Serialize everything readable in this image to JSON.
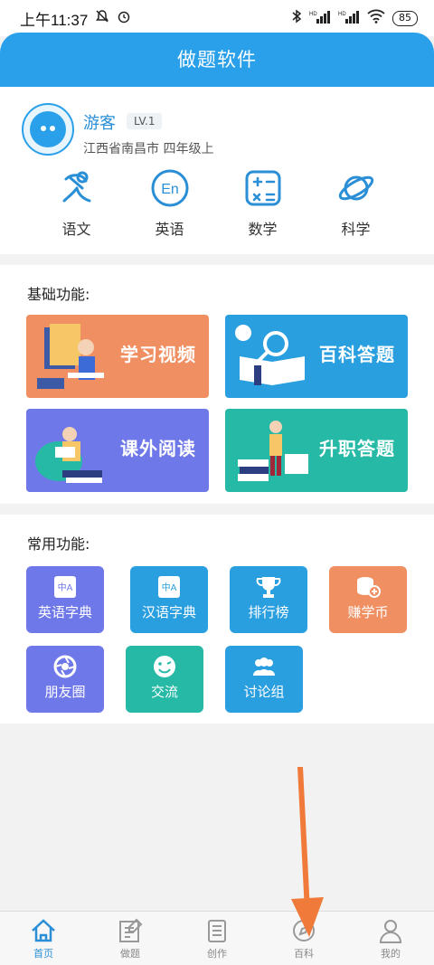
{
  "status": {
    "time": "上午11:37",
    "signal1": "HD",
    "signal2": "HD",
    "battery": "85"
  },
  "app": {
    "title": "做题软件"
  },
  "profile": {
    "name": "游客",
    "level": "LV.1",
    "location": "江西省南昌市  四年级上"
  },
  "subjects": [
    {
      "label": "语文",
      "icon": "chinese-icon"
    },
    {
      "label": "英语",
      "icon": "english-icon",
      "glyph": "En"
    },
    {
      "label": "数学",
      "icon": "math-icon"
    },
    {
      "label": "科学",
      "icon": "science-icon"
    }
  ],
  "basic": {
    "title": "基础功能:",
    "cards": [
      {
        "label": "学习视频",
        "color": "#ef8f62"
      },
      {
        "label": "百科答题",
        "color": "#2a9fe0"
      },
      {
        "label": "课外阅读",
        "color": "#6f78e8"
      },
      {
        "label": "升职答题",
        "color": "#25b9a6"
      }
    ]
  },
  "common": {
    "title": "常用功能:",
    "tiles": [
      {
        "label": "英语字典",
        "color": "#6f78e8",
        "glyph": "中A"
      },
      {
        "label": "汉语字典",
        "color": "#2a9fe0",
        "glyph": "中A"
      },
      {
        "label": "排行榜",
        "color": "#2a9fe0"
      },
      {
        "label": "赚学币",
        "color": "#ef8f62"
      },
      {
        "label": "朋友圈",
        "color": "#6f78e8"
      },
      {
        "label": "交流",
        "color": "#25b9a6"
      },
      {
        "label": "讨论组",
        "color": "#2a9fe0"
      }
    ]
  },
  "tabs": [
    {
      "label": "首页",
      "active": true
    },
    {
      "label": "做题"
    },
    {
      "label": "创作"
    },
    {
      "label": "百科"
    },
    {
      "label": "我的"
    }
  ],
  "colors": {
    "primary": "#2aa0ea",
    "annotation_arrow": "#f07a3a"
  }
}
